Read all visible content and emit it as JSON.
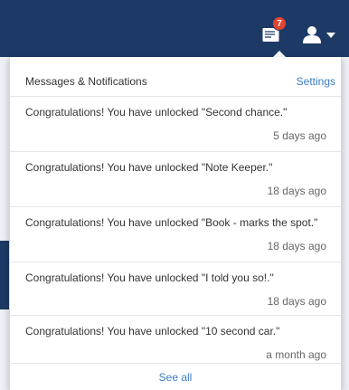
{
  "topbar": {
    "messages_icon": "envelope-icon",
    "badge_count": "7",
    "user_icon": "user-icon",
    "menu_caret": "caret-down-icon",
    "bar_color": "#1d3a66",
    "badge_color": "#e0452f"
  },
  "dropdown": {
    "title": "Messages & Notifications",
    "settings_label": "Settings",
    "accent_color": "#3a7cc4",
    "items": [
      {
        "text": "Congratulations! You have unlocked \"Second chance.\"",
        "time": "5 days ago"
      },
      {
        "text": "Congratulations! You have unlocked \"Note Keeper.\"",
        "time": "18 days ago"
      },
      {
        "text": "Congratulations! You have unlocked \"Book - marks the spot.\"",
        "time": "18 days ago"
      },
      {
        "text": "Congratulations! You have unlocked \"I told you so!.\"",
        "time": "18 days ago"
      },
      {
        "text": "Congratulations! You have unlocked \"10 second car.\"",
        "time": "a month ago"
      }
    ],
    "see_all_label": "See all"
  }
}
